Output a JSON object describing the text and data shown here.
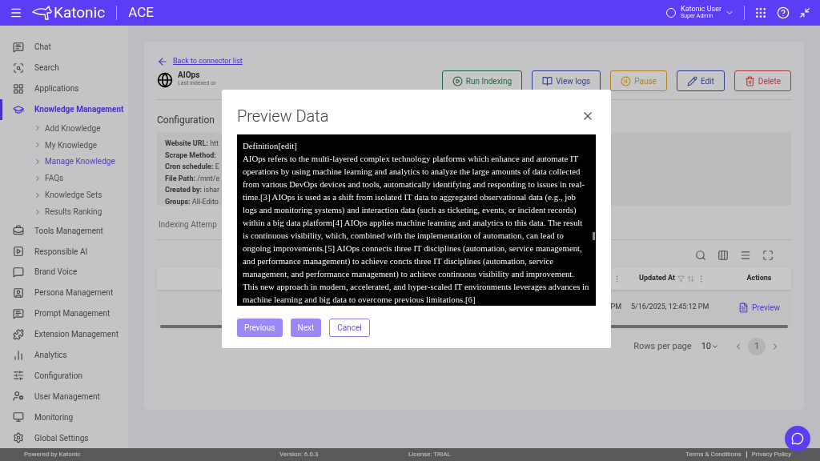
{
  "header": {
    "logo_text": "Katonic",
    "product": "ACE",
    "user_name": "Katonic User",
    "user_role": "Super Admin"
  },
  "sidebar": {
    "items": [
      {
        "kind": "item",
        "label": "Chat",
        "selected": false
      },
      {
        "kind": "item",
        "label": "Search",
        "selected": false
      },
      {
        "kind": "item",
        "label": "Applications",
        "selected": false
      },
      {
        "kind": "item",
        "label": "Knowledge Management",
        "selected": true
      },
      {
        "kind": "subitem",
        "label": "Add Knowledge",
        "selected": false
      },
      {
        "kind": "subitem",
        "label": "My Knowledge",
        "selected": false
      },
      {
        "kind": "subitem",
        "label": "Manage Knowledge",
        "selected": true
      },
      {
        "kind": "subitem",
        "label": "FAQs",
        "selected": false
      },
      {
        "kind": "subitem",
        "label": "Knowledge Sets",
        "selected": false
      },
      {
        "kind": "subitem",
        "label": "Results Ranking",
        "selected": false
      },
      {
        "kind": "item",
        "label": "Tools Management",
        "selected": false
      },
      {
        "kind": "item",
        "label": "Responsible AI",
        "selected": false
      },
      {
        "kind": "item",
        "label": "Brand Voice",
        "selected": false
      },
      {
        "kind": "item",
        "label": "Persona Management",
        "selected": false
      },
      {
        "kind": "item",
        "label": "Prompt Management",
        "selected": false
      },
      {
        "kind": "item",
        "label": "Extension Management",
        "selected": false
      },
      {
        "kind": "item",
        "label": "Analytics",
        "selected": false
      },
      {
        "kind": "item",
        "label": "Configuration",
        "selected": false
      },
      {
        "kind": "item",
        "label": "User Management",
        "selected": false
      },
      {
        "kind": "item",
        "label": "Monitoring",
        "selected": false
      },
      {
        "kind": "item",
        "label": "Global Settings",
        "selected": false
      }
    ]
  },
  "page": {
    "back_link": "Back to connector list",
    "connector_name": "AIOps",
    "last_indexed": "Last indexed or",
    "actions": [
      {
        "kind": "run",
        "label": "Run Indexing"
      },
      {
        "kind": "logs",
        "label": "View logs"
      },
      {
        "kind": "pause",
        "label": "Pause"
      },
      {
        "kind": "edit",
        "label": "Edit"
      },
      {
        "kind": "delete",
        "label": "Delete"
      }
    ],
    "configuration_title": "Configuration",
    "configuration": [
      {
        "label": "Website URL:",
        "value": "htt"
      },
      {
        "label": "Scrape Method:"
      },
      {
        "label": "Cron schedule:",
        "value": "E"
      },
      {
        "label": "File Path:",
        "value": "/mnt/e"
      },
      {
        "label": "Created by:",
        "value": "ishar"
      },
      {
        "label": "Groups:",
        "value": "All-Edito"
      }
    ],
    "tab": "Indexing Attemp",
    "table": {
      "columns": [
        {
          "label": "Updated At"
        },
        {
          "label": "Actions"
        }
      ],
      "rows": [
        {
          "column_1": "PM",
          "updated_at": "5/16/2025, 12:45:12 PM",
          "action": "Preview"
        }
      ]
    },
    "pagination": {
      "rows_per_page_label": "Rows per page",
      "rows_per_page": "10",
      "pages": [
        {
          "label": "1",
          "selected": true
        }
      ]
    }
  },
  "modal": {
    "title": "Preview Data",
    "heading": "Definition[edit]",
    "body": "AIOps refers to the multi-layered complex technology platforms which enhance and automate IT operations by using machine learning and analytics to analyze the large amounts of data collected from various DevOps devices and tools, automatically identifying and responding to issues in real-time.[3] AIOps is used as a shift from isolated IT data to aggregated observational data (e.g., job logs and monitoring systems) and interaction data (such as ticketing, events, or incident records) within a big data platform[4] AIOps applies machine learning and analytics to this data. The result is continuous visibility, which, combined with the implementation of automation, can lead to ongoing improvements.[5] AIOps connects three IT disciplines (automation, service management, and performance management) to achieve concts three IT disciplines (automation, service management, and performance management) to achieve continuous visibility and improvement. This new approach in modern, accelerated, and hyper-scaled IT environments leverages advances in machine learning and big data to overcome previous limitations.[6]",
    "buttons": [
      {
        "kind": "primary",
        "label": "Previous"
      },
      {
        "kind": "primary",
        "label": "Next"
      },
      {
        "kind": "outline",
        "label": "Cancel"
      }
    ]
  },
  "footer": {
    "powered_by": "Powered by Katonic",
    "version": "Version: 6.0.3",
    "license": "License: TRIAL",
    "links": [
      "Terms & Conditions",
      "Privacy Policy"
    ]
  }
}
